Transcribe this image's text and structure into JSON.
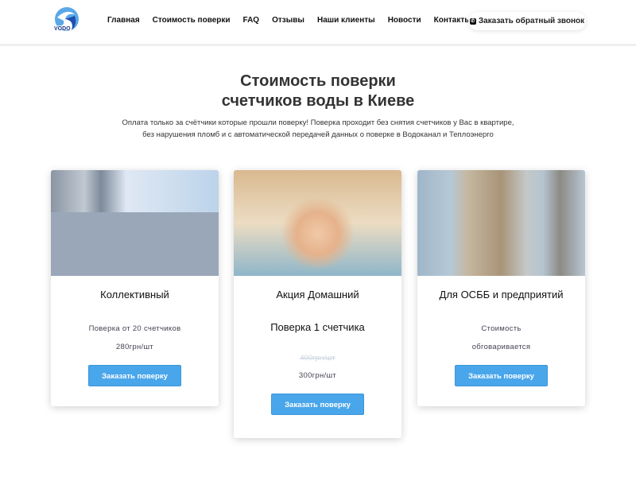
{
  "header": {
    "logo": "VODO",
    "nav": [
      "Главная",
      "Стоимость поверки",
      "FAQ",
      "Отзывы",
      "Наши клиенты",
      "Новости",
      "Контакты"
    ],
    "callback": "Заказать обратный звонок"
  },
  "hero": {
    "title1": "Стоимость поверки",
    "title2": "счетчиков воды в Киеве",
    "lead1": "Оплата только за счётчики которые прошли поверку! Поверка проходит без снятия счетчиков у Вас в квартире,",
    "lead2": "без нарушения пломб и с автоматической передачей данных о поверке в Водоканал и Теплоэнерго"
  },
  "cards": [
    {
      "title": "Коллективный",
      "line1": "Поверка от 20 счетчиков",
      "line2": "280грн/шт",
      "button": "Заказать поверку"
    },
    {
      "title": "Акция Домашний",
      "subtitle": "Поверка 1 счетчика",
      "old_price": "400грн/шт",
      "price": "300грн/шт",
      "button": "Заказать поверку"
    },
    {
      "title": "Для ОСББ и предприятий",
      "line1": "Стоимость",
      "line2": "обговаривается",
      "button": "Заказать поверку"
    }
  ],
  "colors": {
    "accent": "#4aa6ea"
  }
}
